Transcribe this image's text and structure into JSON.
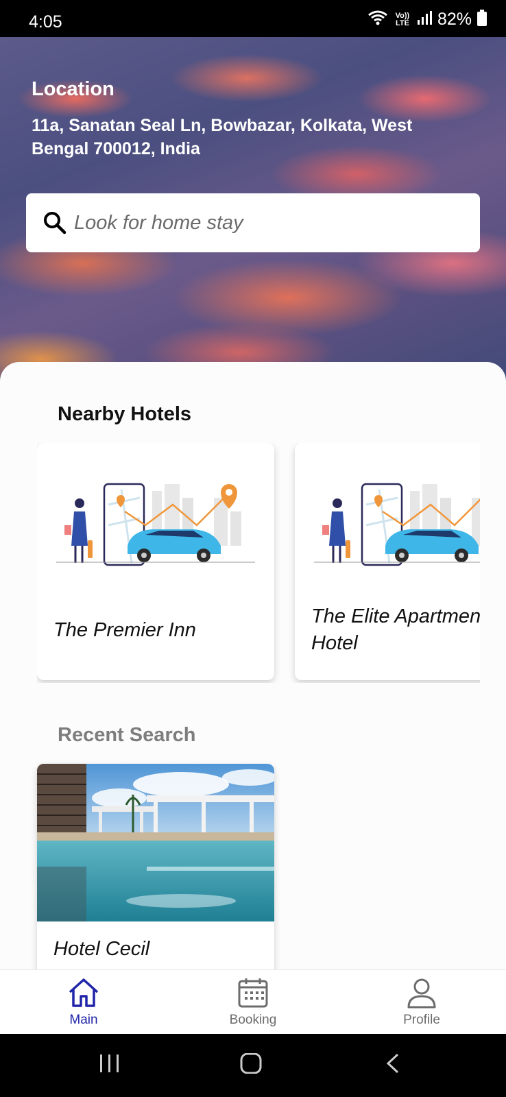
{
  "status_bar": {
    "time": "4:05",
    "volte": "Vo)) LTE",
    "battery": "82%",
    "icons": [
      "wifi-icon",
      "volte-icon",
      "signal-icon",
      "battery-icon"
    ]
  },
  "location": {
    "title": "Location",
    "address": "11a, Sanatan Seal Ln, Bowbazar, Kolkata, West Bengal 700012, India"
  },
  "search": {
    "placeholder": "Look for home stay",
    "value": ""
  },
  "nearby": {
    "title": "Nearby Hotels",
    "hotels": [
      {
        "name": "The Premier Inn"
      },
      {
        "name": "The Elite Apartment Hotel"
      }
    ]
  },
  "recent": {
    "title": "Recent Search",
    "items": [
      {
        "name": "Hotel Cecil"
      }
    ]
  },
  "bottom_nav": {
    "items": [
      {
        "label": "Main",
        "icon": "home-icon",
        "active": true
      },
      {
        "label": "Booking",
        "icon": "calendar-icon",
        "active": false
      },
      {
        "label": "Profile",
        "icon": "user-icon",
        "active": false
      }
    ]
  },
  "colors": {
    "accent": "#1f24a8",
    "inactive": "#6c6c6c",
    "car": "#3fb6e8",
    "pin": "#f0963a"
  }
}
